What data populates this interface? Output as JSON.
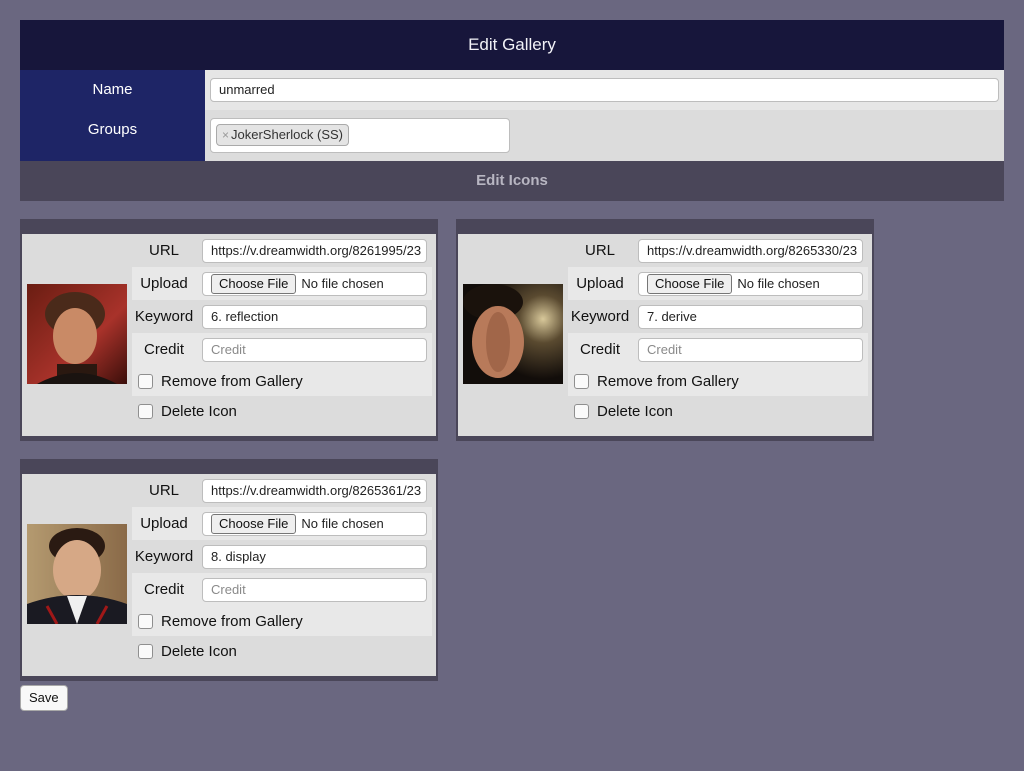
{
  "title": "Edit Gallery",
  "name": {
    "label": "Name",
    "value": "unmarred"
  },
  "groups": {
    "label": "Groups",
    "tags": [
      {
        "remove": "×",
        "text": "JokerSherlock (SS)"
      }
    ]
  },
  "section_title": "Edit Icons",
  "field_labels": {
    "url": "URL",
    "upload": "Upload",
    "keyword": "Keyword",
    "credit": "Credit",
    "remove": "Remove from Gallery",
    "delete": "Delete Icon",
    "choose_file": "Choose File",
    "no_file": "No file chosen",
    "credit_placeholder": "Credit"
  },
  "icons": [
    {
      "url": "https://v.dreamwidth.org/8261995/23",
      "keyword": "6. reflection",
      "credit": ""
    },
    {
      "url": "https://v.dreamwidth.org/8265330/23",
      "keyword": "7. derive",
      "credit": ""
    },
    {
      "url": "https://v.dreamwidth.org/8265361/23",
      "keyword": "8. display",
      "credit": ""
    }
  ],
  "save_label": "Save",
  "colors": {
    "header": "#17163b",
    "label_column": "#1e2566",
    "section_bar": "#4a4659",
    "background": "#6a6780"
  }
}
